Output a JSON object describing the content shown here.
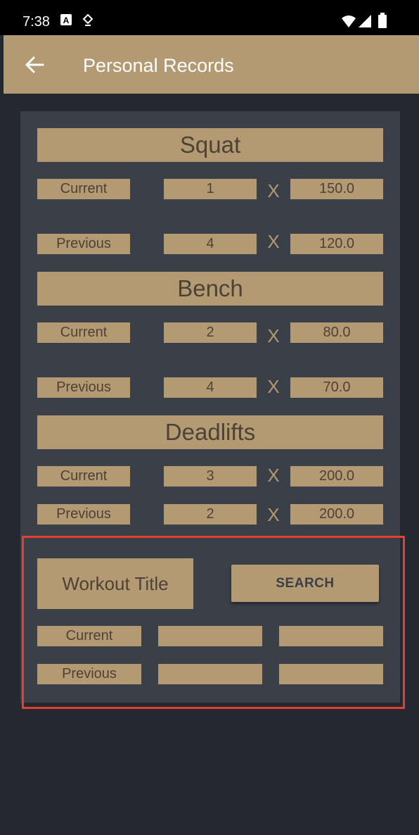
{
  "status": {
    "time": "7:38"
  },
  "appbar": {
    "title": "Personal Records"
  },
  "exercises": [
    {
      "name": "Squat",
      "current": {
        "label": "Current",
        "reps": "1",
        "weight": "150.0"
      },
      "previous": {
        "label": "Previous",
        "reps": "4",
        "weight": "120.0"
      }
    },
    {
      "name": "Bench",
      "current": {
        "label": "Current",
        "reps": "2",
        "weight": "80.0"
      },
      "previous": {
        "label": "Previous",
        "reps": "4",
        "weight": "70.0"
      }
    },
    {
      "name": "Deadlifts",
      "current": {
        "label": "Current",
        "reps": "3",
        "weight": "200.0"
      },
      "previous": {
        "label": "Previous",
        "reps": "2",
        "weight": "200.0"
      }
    }
  ],
  "times_symbol": "X",
  "search_section": {
    "workout_title": "Workout Title",
    "search_button": "SEARCH",
    "current_label": "Current",
    "previous_label": "Previous",
    "current_reps": "",
    "current_weight": "",
    "previous_reps": "",
    "previous_weight": ""
  },
  "colors": {
    "accent": "#b39a73",
    "card": "#3b3f47",
    "background": "#252830",
    "highlight": "#e2412f"
  }
}
